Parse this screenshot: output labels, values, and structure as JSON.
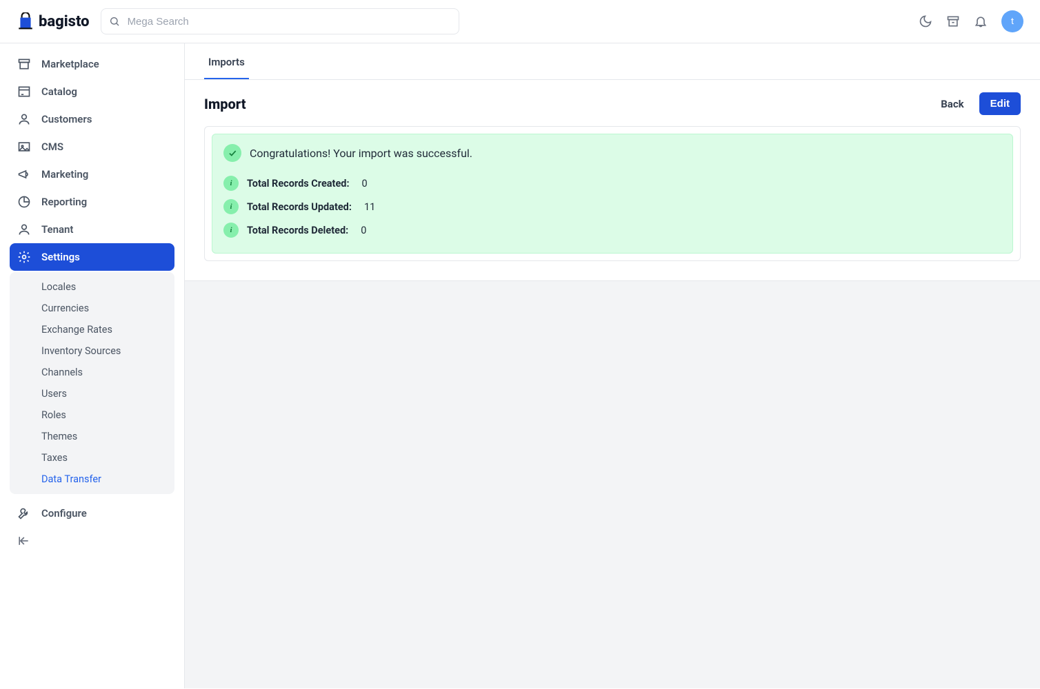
{
  "brand": {
    "name": "bagisto"
  },
  "search": {
    "placeholder": "Mega Search"
  },
  "avatar": {
    "initial": "t"
  },
  "sidebar": {
    "items": [
      {
        "label": "Marketplace"
      },
      {
        "label": "Catalog"
      },
      {
        "label": "Customers"
      },
      {
        "label": "CMS"
      },
      {
        "label": "Marketing"
      },
      {
        "label": "Reporting"
      },
      {
        "label": "Tenant"
      },
      {
        "label": "Settings"
      },
      {
        "label": "Configure"
      }
    ],
    "settings_sub": [
      {
        "label": "Locales"
      },
      {
        "label": "Currencies"
      },
      {
        "label": "Exchange Rates"
      },
      {
        "label": "Inventory Sources"
      },
      {
        "label": "Channels"
      },
      {
        "label": "Users"
      },
      {
        "label": "Roles"
      },
      {
        "label": "Themes"
      },
      {
        "label": "Taxes"
      },
      {
        "label": "Data Transfer"
      }
    ]
  },
  "tabs": {
    "imports": "Imports"
  },
  "page": {
    "title": "Import",
    "back": "Back",
    "edit": "Edit"
  },
  "result": {
    "message": "Congratulations! Your import was successful.",
    "stats": [
      {
        "label": "Total Records Created:",
        "value": "0"
      },
      {
        "label": "Total Records Updated:",
        "value": "11"
      },
      {
        "label": "Total Records Deleted:",
        "value": "0"
      }
    ]
  }
}
